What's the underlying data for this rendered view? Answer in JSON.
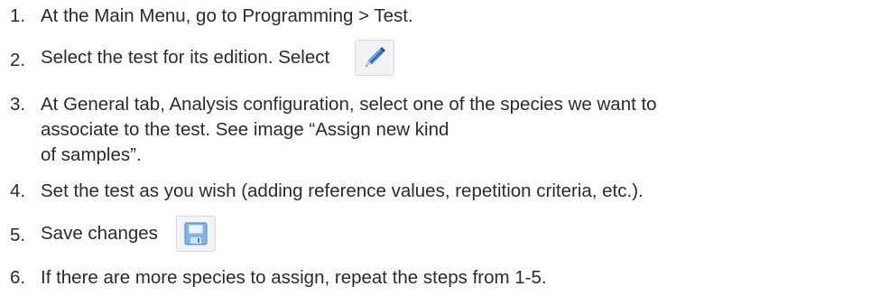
{
  "steps": [
    {
      "number": "1.",
      "lines": [
        "At the Main Menu, go to Programming > Test."
      ]
    },
    {
      "number": "2.",
      "lines": [
        "Select the test for its edition. Select"
      ],
      "icon": "pencil-edit-icon"
    },
    {
      "number": "3.",
      "lines": [
        "At General tab, Analysis configuration, select one of the species we want to",
        "associate to the test. See image “Assign new kind",
        "of samples”."
      ]
    },
    {
      "number": "4.",
      "lines": [
        "Set the test as you wish (adding reference values, repetition criteria, etc.)."
      ]
    },
    {
      "number": "5.",
      "lines": [
        "Save changes"
      ],
      "icon": "save-disk-icon"
    },
    {
      "number": "6.",
      "lines": [
        "If there are more species to assign, repeat the steps from 1-5."
      ]
    }
  ],
  "colors": {
    "text": "#2b2b2b",
    "icon_background": "#f3f3f3",
    "pencil_blue": "#2f6fd6",
    "disk_blue": "#7fb6e6"
  }
}
